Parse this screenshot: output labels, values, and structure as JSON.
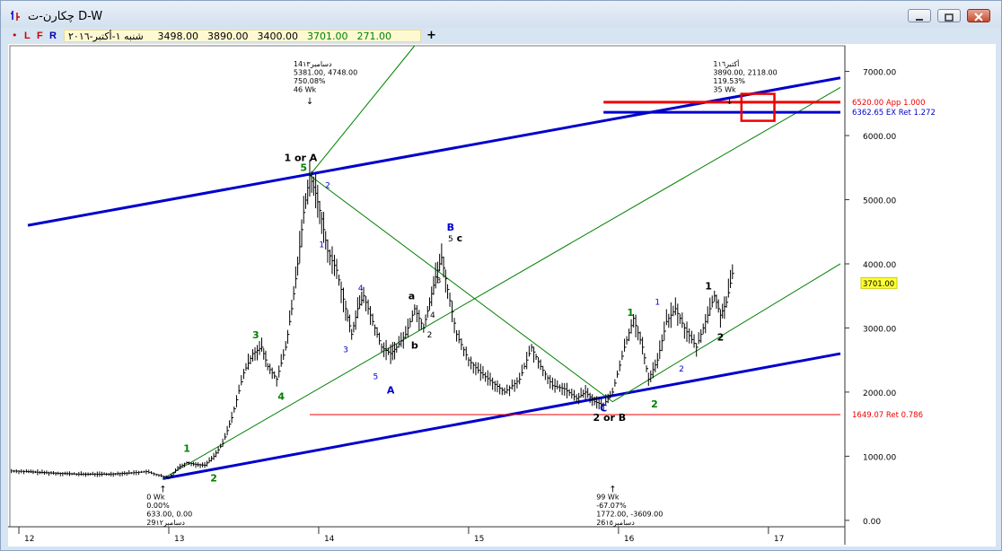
{
  "window": {
    "title": "چکارن-ت D-W",
    "buttons": [
      "minimize",
      "restore",
      "close"
    ]
  },
  "toolbar": {
    "dot": "•",
    "letters": [
      "L",
      "F",
      "R"
    ],
    "info": {
      "date": "شنبه ١-أكتبر-٢٠١٦",
      "open": "3498.00",
      "high": "3890.00",
      "low": "3400.00",
      "close": "3701.00",
      "change": "271.00"
    },
    "crosshair": "+"
  },
  "chart_data": {
    "type": "line",
    "style": "ohlc-bars",
    "xlabels": [
      "12",
      "13",
      "14",
      "15",
      "16",
      "17"
    ],
    "ylabels": [
      "0.00",
      "1000.00",
      "2000.00",
      "3000.00",
      "4000.00",
      "5000.00",
      "6000.00",
      "7000.00"
    ],
    "ylim": [
      -100,
      7400
    ],
    "xlim": [
      11.94,
      17.51
    ],
    "last_price_label": "3701.00",
    "price_path": [
      [
        11.95,
        770
      ],
      [
        12.05,
        760
      ],
      [
        12.2,
        740
      ],
      [
        12.4,
        720
      ],
      [
        12.6,
        720
      ],
      [
        12.75,
        740
      ],
      [
        12.85,
        760
      ],
      [
        12.95,
        690
      ],
      [
        13.0,
        660
      ],
      [
        13.06,
        820
      ],
      [
        13.12,
        900
      ],
      [
        13.18,
        870
      ],
      [
        13.24,
        860
      ],
      [
        13.3,
        1000
      ],
      [
        13.36,
        1200
      ],
      [
        13.42,
        1600
      ],
      [
        13.5,
        2300
      ],
      [
        13.56,
        2600
      ],
      [
        13.62,
        2700
      ],
      [
        13.66,
        2400
      ],
      [
        13.72,
        2200
      ],
      [
        13.78,
        2700
      ],
      [
        13.82,
        3300
      ],
      [
        13.86,
        4000
      ],
      [
        13.9,
        4800
      ],
      [
        13.94,
        5380
      ],
      [
        13.98,
        5100
      ],
      [
        14.02,
        4700
      ],
      [
        14.06,
        4200
      ],
      [
        14.12,
        3900
      ],
      [
        14.18,
        3300
      ],
      [
        14.22,
        2900
      ],
      [
        14.26,
        3300
      ],
      [
        14.3,
        3500
      ],
      [
        14.36,
        3100
      ],
      [
        14.42,
        2700
      ],
      [
        14.48,
        2600
      ],
      [
        14.52,
        2700
      ],
      [
        14.58,
        2900
      ],
      [
        14.64,
        3300
      ],
      [
        14.7,
        3000
      ],
      [
        14.74,
        3400
      ],
      [
        14.78,
        3800
      ],
      [
        14.82,
        4100
      ],
      [
        14.86,
        3600
      ],
      [
        14.92,
        2900
      ],
      [
        15.0,
        2500
      ],
      [
        15.08,
        2300
      ],
      [
        15.16,
        2150
      ],
      [
        15.24,
        2000
      ],
      [
        15.34,
        2200
      ],
      [
        15.42,
        2700
      ],
      [
        15.48,
        2400
      ],
      [
        15.56,
        2100
      ],
      [
        15.64,
        2050
      ],
      [
        15.72,
        1900
      ],
      [
        15.78,
        2000
      ],
      [
        15.84,
        1850
      ],
      [
        15.9,
        1800
      ],
      [
        15.96,
        2000
      ],
      [
        16.04,
        2700
      ],
      [
        16.1,
        3150
      ],
      [
        16.16,
        2700
      ],
      [
        16.2,
        2200
      ],
      [
        16.26,
        2500
      ],
      [
        16.32,
        3100
      ],
      [
        16.38,
        3300
      ],
      [
        16.44,
        3000
      ],
      [
        16.52,
        2700
      ],
      [
        16.58,
        3100
      ],
      [
        16.64,
        3500
      ],
      [
        16.68,
        3200
      ],
      [
        16.72,
        3400
      ],
      [
        16.76,
        3850
      ],
      [
        16.78,
        3701
      ]
    ],
    "trendlines": [
      {
        "color": "#0000cc",
        "width": 3,
        "from": [
          12.06,
          4600
        ],
        "to": [
          17.48,
          6900
        ]
      },
      {
        "color": "#0000cc",
        "width": 3,
        "from": [
          12.96,
          650
        ],
        "to": [
          17.48,
          2600
        ]
      },
      {
        "color": "#008000",
        "width": 1,
        "from": [
          12.96,
          650
        ],
        "to": [
          17.48,
          6750
        ]
      },
      {
        "color": "#008000",
        "width": 1,
        "from": [
          13.94,
          5380
        ],
        "to": [
          14.64,
          7400
        ]
      },
      {
        "color": "#008000",
        "width": 1,
        "from": [
          13.94,
          5380
        ],
        "to": [
          15.96,
          1850
        ]
      },
      {
        "color": "#008000",
        "width": 1,
        "from": [
          15.96,
          1850
        ],
        "to": [
          17.48,
          4000
        ]
      }
    ],
    "horizontal_lines": [
      {
        "y": 6520,
        "from": 15.9,
        "to": 17.48,
        "color": "#ee0000",
        "width": 3,
        "label": "6520.00 App 1.000"
      },
      {
        "y": 6362.65,
        "from": 15.9,
        "to": 17.48,
        "color": "#0000cc",
        "width": 3,
        "label": "6362.65 EX Ret 1.272"
      },
      {
        "y": 1649.07,
        "from": 13.94,
        "to": 17.48,
        "color": "#ee0000",
        "width": 1,
        "label": "1649.07 Ret 0.786"
      }
    ],
    "target_box": {
      "x0": 16.82,
      "x1": 17.04,
      "y0": 6230,
      "y1": 6650,
      "color": "#ee0000"
    },
    "info_blocks": [
      {
        "x": 13.94,
        "y": 7080,
        "arrow": "down",
        "lines": [
          "14دسامبر١٣",
          "5381.00, 4748.00",
          "750.08%",
          "46 Wk"
        ]
      },
      {
        "x": 16.74,
        "y": 7080,
        "arrow": "down",
        "lines": [
          "1أكتبر١٦",
          "3890.00, 2118.00",
          "119.53%",
          "35 Wk"
        ]
      },
      {
        "x": 12.96,
        "y": 520,
        "arrow": "up",
        "lines": [
          "0 Wk",
          "0.00%",
          "633.00, 0.00",
          "29دسامبر١٢"
        ]
      },
      {
        "x": 15.96,
        "y": 520,
        "arrow": "up",
        "lines": [
          "99 Wk",
          "-67.07%",
          "1772.00, -3609.00",
          "26دسامبر١٥"
        ]
      }
    ],
    "wave_labels": [
      {
        "text": "1",
        "x": 13.12,
        "y": 1070,
        "color": "#008000",
        "bold": true
      },
      {
        "text": "2",
        "x": 13.3,
        "y": 610,
        "color": "#008000",
        "bold": true
      },
      {
        "text": "3",
        "x": 13.58,
        "y": 2840,
        "color": "#008000",
        "bold": true
      },
      {
        "text": "4",
        "x": 13.75,
        "y": 1880,
        "color": "#008000",
        "bold": true
      },
      {
        "text": "5",
        "x": 13.9,
        "y": 5450,
        "color": "#008000",
        "bold": true
      },
      {
        "text": "1 or A",
        "x": 13.88,
        "y": 5600,
        "color": "#000000",
        "bold": true
      },
      {
        "text": "2",
        "x": 14.06,
        "y": 5180,
        "color": "#0000cc",
        "bold": false
      },
      {
        "text": "1",
        "x": 14.02,
        "y": 4260,
        "color": "#0000cc",
        "bold": false
      },
      {
        "text": "3",
        "x": 14.18,
        "y": 2620,
        "color": "#0000cc",
        "bold": false
      },
      {
        "text": "4",
        "x": 14.28,
        "y": 3580,
        "color": "#0000cc",
        "bold": false
      },
      {
        "text": "5",
        "x": 14.38,
        "y": 2200,
        "color": "#0000cc",
        "bold": false
      },
      {
        "text": "A",
        "x": 14.48,
        "y": 1980,
        "color": "#0000cc",
        "bold": true
      },
      {
        "text": "a",
        "x": 14.62,
        "y": 3450,
        "color": "#000000",
        "bold": true
      },
      {
        "text": "b",
        "x": 14.64,
        "y": 2680,
        "color": "#000000",
        "bold": true
      },
      {
        "text": "3",
        "x": 14.8,
        "y": 3700,
        "color": "#000000",
        "bold": false
      },
      {
        "text": "4",
        "x": 14.76,
        "y": 3160,
        "color": "#000000",
        "bold": false
      },
      {
        "text": "2",
        "x": 14.74,
        "y": 2850,
        "color": "#000000",
        "bold": false
      },
      {
        "text": "B",
        "x": 14.88,
        "y": 4520,
        "color": "#0000cc",
        "bold": true
      },
      {
        "text": "5",
        "x": 14.88,
        "y": 4350,
        "color": "#000000",
        "bold": false
      },
      {
        "text": "c",
        "x": 14.94,
        "y": 4350,
        "color": "#000000",
        "bold": true
      },
      {
        "text": "C",
        "x": 15.9,
        "y": 1700,
        "color": "#0000cc",
        "bold": true
      },
      {
        "text": "2 or B",
        "x": 15.94,
        "y": 1550,
        "color": "#000000",
        "bold": true
      },
      {
        "text": "1",
        "x": 16.08,
        "y": 3190,
        "color": "#008000",
        "bold": true
      },
      {
        "text": "2",
        "x": 16.24,
        "y": 1760,
        "color": "#008000",
        "bold": true
      },
      {
        "text": "1",
        "x": 16.26,
        "y": 3360,
        "color": "#0000cc",
        "bold": false
      },
      {
        "text": "2",
        "x": 16.42,
        "y": 2320,
        "color": "#0000cc",
        "bold": false
      },
      {
        "text": "1",
        "x": 16.6,
        "y": 3600,
        "color": "#000000",
        "bold": true
      },
      {
        "text": "2",
        "x": 16.68,
        "y": 2800,
        "color": "#000000",
        "bold": true
      }
    ]
  }
}
